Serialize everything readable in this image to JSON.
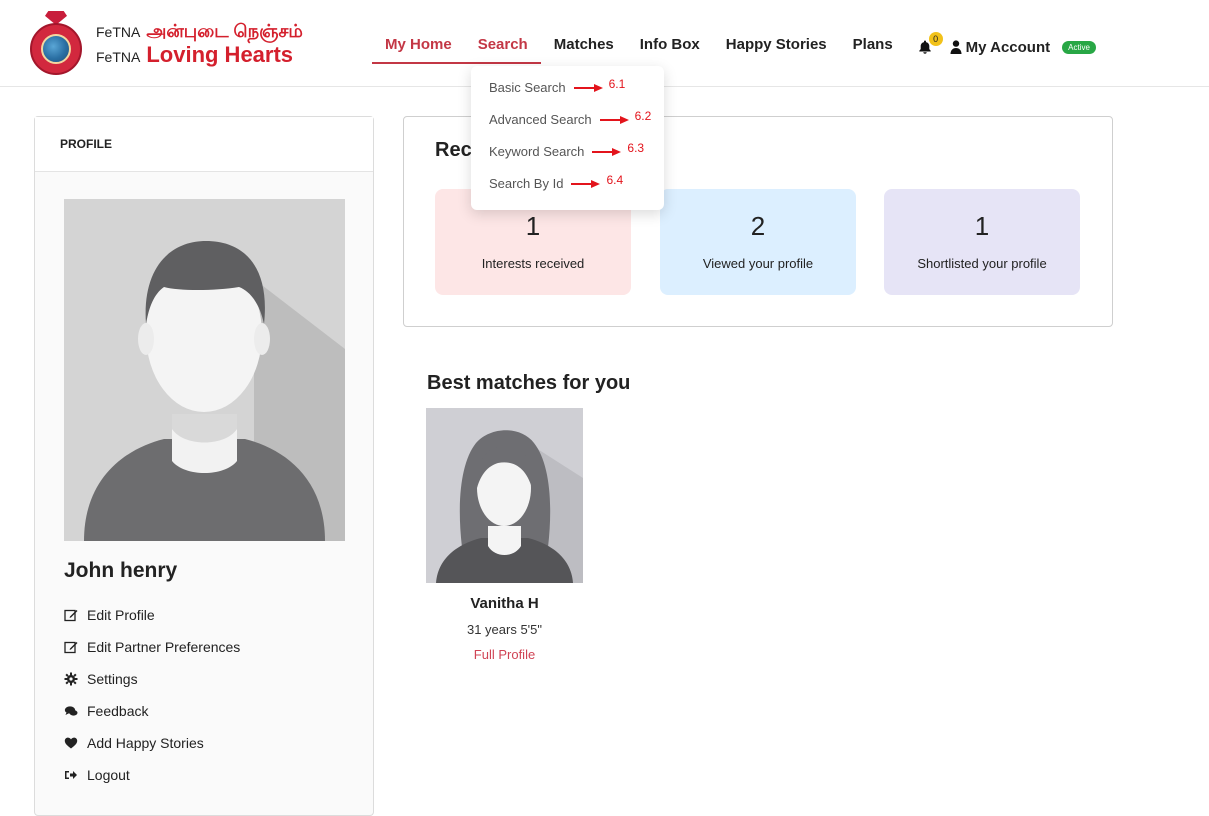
{
  "header": {
    "logo": {
      "line1_prefix": "FeTNA",
      "line1_tamil": "அன்புடை நெஞ்சம்",
      "line2_prefix": "FeTNA",
      "line2_main": "Loving Hearts"
    },
    "nav": [
      {
        "label": "My Home"
      },
      {
        "label": "Search"
      },
      {
        "label": "Matches"
      },
      {
        "label": "Info Box"
      },
      {
        "label": "Happy Stories"
      },
      {
        "label": "Plans"
      }
    ],
    "notifications_count": "0",
    "account_label": "My Account",
    "account_status": "Active"
  },
  "search_dropdown": {
    "items": [
      {
        "label": "Basic Search",
        "annotation": "6.1"
      },
      {
        "label": "Advanced Search",
        "annotation": "6.2"
      },
      {
        "label": "Keyword Search",
        "annotation": "6.3"
      },
      {
        "label": "Search By Id",
        "annotation": "6.4"
      }
    ]
  },
  "profile": {
    "heading": "PROFILE",
    "name": "John henry",
    "menu": [
      {
        "label": "Edit Profile",
        "icon": "edit-icon"
      },
      {
        "label": "Edit Partner Preferences",
        "icon": "edit-icon"
      },
      {
        "label": "Settings",
        "icon": "gear-icon"
      },
      {
        "label": "Feedback",
        "icon": "comments-icon"
      },
      {
        "label": "Add Happy Stories",
        "icon": "heart-icon"
      },
      {
        "label": "Logout",
        "icon": "logout-icon"
      }
    ]
  },
  "recent": {
    "title": "Rec",
    "stats": [
      {
        "value": "1",
        "label": "Interests received",
        "color": "#fde6e6"
      },
      {
        "value": "2",
        "label": "Viewed your profile",
        "color": "#dcefff"
      },
      {
        "value": "1",
        "label": "Shortlisted your profile",
        "color": "#e6e4f6"
      }
    ]
  },
  "best_matches": {
    "title": "Best matches for you",
    "items": [
      {
        "name": "Vanitha H",
        "meta": "31 years 5'5\"",
        "link": "Full Profile"
      }
    ]
  },
  "colors": {
    "accent": "#c33745",
    "annotation_red": "#e3141c",
    "active_green": "#28a745",
    "badge_yellow": "#f2c21a"
  }
}
